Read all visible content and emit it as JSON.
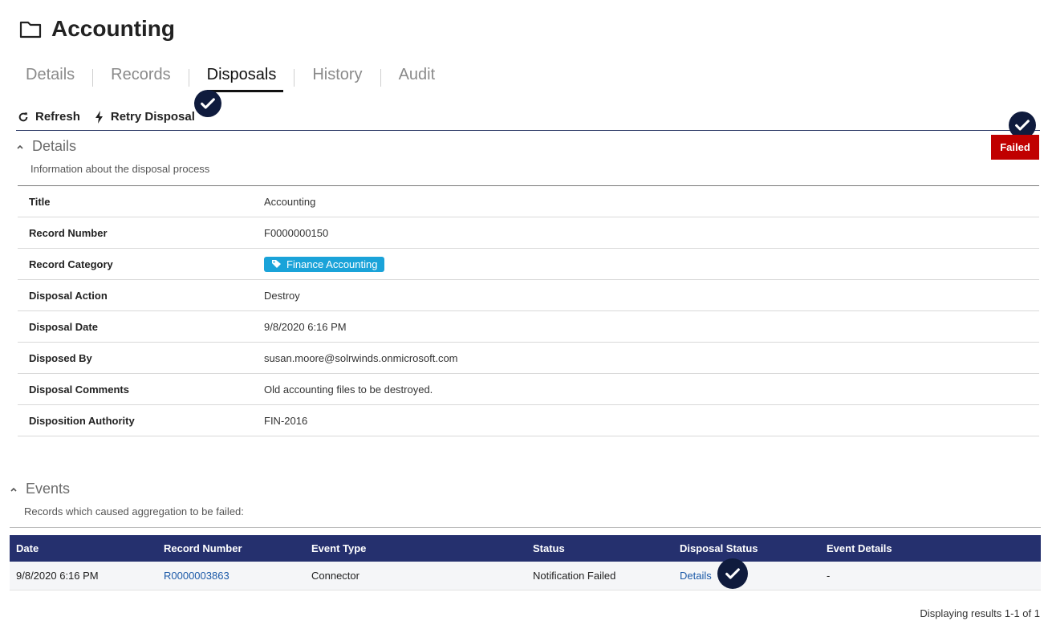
{
  "page": {
    "title": "Accounting",
    "icon": "folder-icon"
  },
  "tabs": [
    {
      "label": "Details",
      "active": false
    },
    {
      "label": "Records",
      "active": false
    },
    {
      "label": "Disposals",
      "active": true
    },
    {
      "label": "History",
      "active": false
    },
    {
      "label": "Audit",
      "active": false
    }
  ],
  "toolbar": {
    "refresh_label": "Refresh",
    "retry_label": "Retry Disposal"
  },
  "details": {
    "heading": "Details",
    "subtitle": "Information about the disposal process",
    "status_badge": "Failed",
    "status_color": "#c00000",
    "rows": [
      {
        "label": "Title",
        "value": "Accounting"
      },
      {
        "label": "Record Number",
        "value": "F0000000150"
      },
      {
        "label": "Record Category",
        "value": "Finance Accounting"
      },
      {
        "label": "Disposal Action",
        "value": "Destroy"
      },
      {
        "label": "Disposal Date",
        "value": "9/8/2020 6:16 PM"
      },
      {
        "label": "Disposed By",
        "value": "susan.moore@solrwinds.onmicrosoft.com"
      },
      {
        "label": "Disposal Comments",
        "value": "Old accounting files to be destroyed."
      },
      {
        "label": "Disposition Authority",
        "value": "FIN-2016"
      }
    ]
  },
  "events": {
    "heading": "Events",
    "subtitle": "Records which caused aggregation to be failed:",
    "columns": [
      "Date",
      "Record Number",
      "Event Type",
      "Status",
      "Disposal Status",
      "Event Details"
    ],
    "rows": [
      [
        "9/8/2020 6:16 PM",
        "R0000003863",
        "Connector",
        "Notification Failed",
        "Details",
        "-"
      ]
    ],
    "header_color": "#25306e"
  },
  "pager": {
    "text": "Displaying results 1-1 of 1"
  },
  "colors": {
    "accent": "#25306e",
    "tag": "#1aa3d9",
    "link": "#1c5aa8",
    "badge_dark": "#0f1b3d"
  }
}
